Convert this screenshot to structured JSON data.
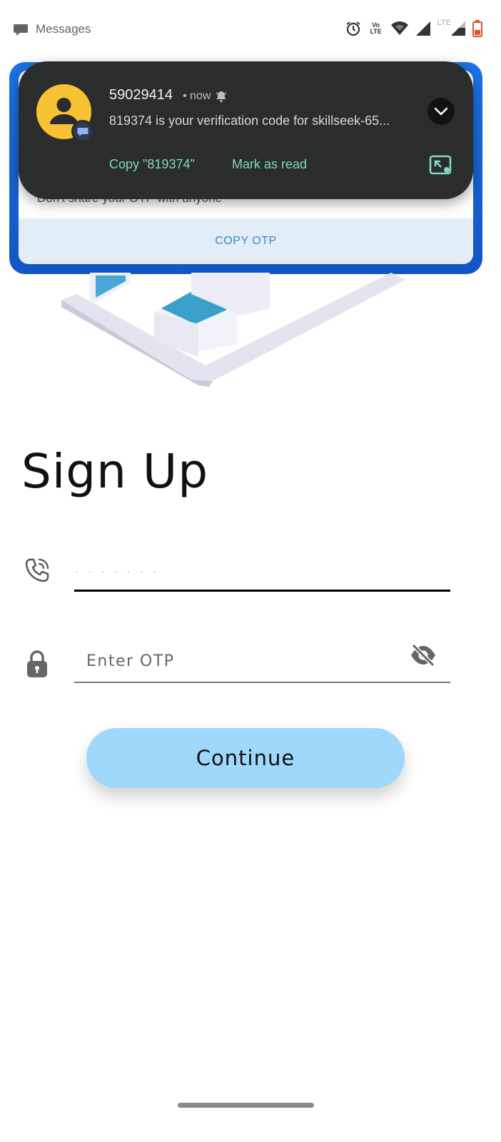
{
  "status_bar": {
    "app_label": "Messages",
    "volte_label": "Vo LTE",
    "lte_label": "LTE",
    "icons": [
      "message-bubble-icon",
      "alarm-icon",
      "volte-icon",
      "wifi-icon",
      "signal-icon",
      "lte-signal-icon",
      "battery-icon"
    ]
  },
  "otp_card": {
    "hint": "Don't share your OTP with anyone",
    "copy_label": "COPY OTP"
  },
  "notification": {
    "sender": "59029414",
    "time": "• now",
    "body": "819374 is your verification code for skillseek-65...",
    "actions": {
      "copy": "Copy \"819374\"",
      "mark_read": "Mark as read"
    },
    "colors": {
      "background": "#2b2c2c",
      "action": "#7fd8c2",
      "avatar": "#f8c234"
    }
  },
  "form": {
    "title": "Sign Up",
    "phone_value": "· · · · · ·   ·",
    "otp_placeholder": "Enter OTP",
    "continue_label": "Continue"
  },
  "colors": {
    "button": "#9fd8fb",
    "card_frame": "#1a73e8"
  }
}
